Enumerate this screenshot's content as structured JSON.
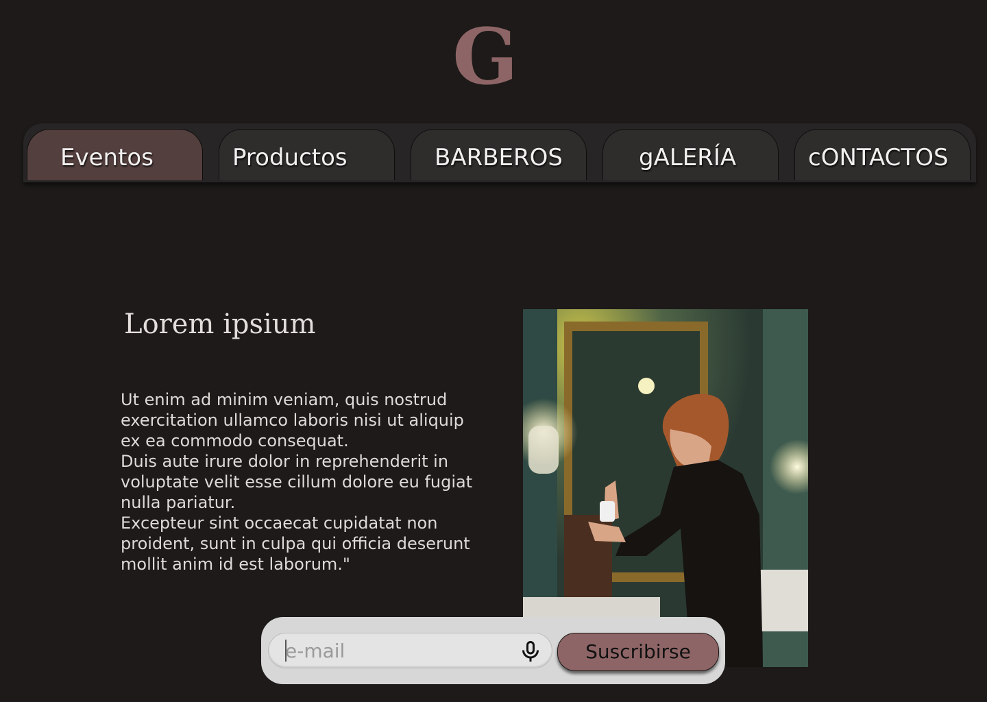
{
  "logo": {
    "letter": "G"
  },
  "nav": {
    "tabs": [
      {
        "label": "Eventos",
        "active": true
      },
      {
        "label": "Productos",
        "active": false
      },
      {
        "label": "BARBEROS",
        "active": false
      },
      {
        "label": "gALERÍA",
        "active": false
      },
      {
        "label": "cONTACTOS",
        "active": false
      }
    ]
  },
  "main": {
    "heading": "Lorem ipsium",
    "paragraph_lines": [
      "Ut enim ad minim veniam, quis nostrud",
      "exercitation ullamco laboris nisi ut aliquip",
      "ex ea commodo consequat.",
      "Duis aute irure dolor in reprehenderit in",
      "voluptate velit esse cillum dolore eu fugiat",
      "nulla pariatur.",
      "Excepteur sint occaecat cupidatat non",
      "proident, sunt in culpa qui officia deserunt",
      "mollit anim id est laborum.\""
    ]
  },
  "subscribe": {
    "email_placeholder": "e-mail",
    "email_value": "",
    "button_label": "Suscribirse",
    "mic_icon": "microphone-icon"
  },
  "colors": {
    "background": "#1d1a19",
    "accent": "#8e6566",
    "tab_active": "#533f3e",
    "tab_inactive": "#2e2d2c"
  }
}
